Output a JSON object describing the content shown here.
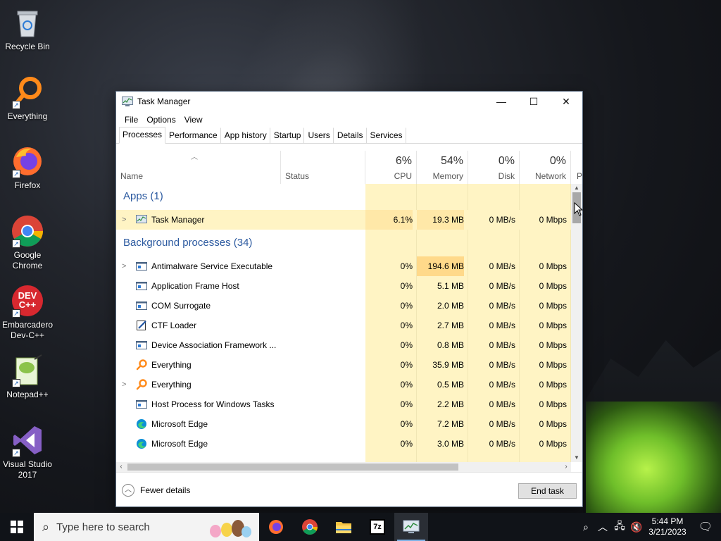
{
  "desktop": {
    "icons": [
      {
        "label": "Recycle Bin",
        "icon": "recycle-bin-icon"
      },
      {
        "label": "Everything",
        "icon": "everything-icon"
      },
      {
        "label": "Firefox",
        "icon": "firefox-icon"
      },
      {
        "label": "Google Chrome",
        "icon": "chrome-icon"
      },
      {
        "label": "Embarcadero Dev-C++",
        "icon": "devcpp-icon"
      },
      {
        "label": "Notepad++",
        "icon": "notepadpp-icon"
      },
      {
        "label": "Visual Studio 2017",
        "icon": "visual-studio-icon"
      }
    ],
    "devcpp_badge": "DEV C++"
  },
  "window": {
    "title": "Task Manager",
    "controls": {
      "minimize": "—",
      "maximize": "☐",
      "close": "✕"
    },
    "menu": [
      "File",
      "Options",
      "View"
    ],
    "tabs": [
      "Processes",
      "Performance",
      "App history",
      "Startup",
      "Users",
      "Details",
      "Services"
    ],
    "active_tab": "Processes"
  },
  "columns": {
    "name": "Name",
    "status": "Status",
    "cpu": {
      "pct": "6%",
      "label": "CPU"
    },
    "memory": {
      "pct": "54%",
      "label": "Memory"
    },
    "disk": {
      "pct": "0%",
      "label": "Disk"
    },
    "network": {
      "pct": "0%",
      "label": "Network"
    },
    "power_partial": "P"
  },
  "groups": {
    "apps": "Apps (1)",
    "background": "Background processes (34)"
  },
  "apps": [
    {
      "name": "Task Manager",
      "cpu": "6.1%",
      "memory": "19.3 MB",
      "disk": "0 MB/s",
      "network": "0 Mbps",
      "expand": true
    }
  ],
  "background": [
    {
      "name": "Antimalware Service Executable",
      "cpu": "0%",
      "memory": "194.6 MB",
      "disk": "0 MB/s",
      "network": "0 Mbps",
      "expand": true
    },
    {
      "name": "Application Frame Host",
      "cpu": "0%",
      "memory": "5.1 MB",
      "disk": "0 MB/s",
      "network": "0 Mbps",
      "expand": false
    },
    {
      "name": "COM Surrogate",
      "cpu": "0%",
      "memory": "2.0 MB",
      "disk": "0 MB/s",
      "network": "0 Mbps",
      "expand": false
    },
    {
      "name": "CTF Loader",
      "cpu": "0%",
      "memory": "2.7 MB",
      "disk": "0 MB/s",
      "network": "0 Mbps",
      "expand": false
    },
    {
      "name": "Device Association Framework ...",
      "cpu": "0%",
      "memory": "0.8 MB",
      "disk": "0 MB/s",
      "network": "0 Mbps",
      "expand": false
    },
    {
      "name": "Everything",
      "cpu": "0%",
      "memory": "35.9 MB",
      "disk": "0 MB/s",
      "network": "0 Mbps",
      "expand": false
    },
    {
      "name": "Everything",
      "cpu": "0%",
      "memory": "0.5 MB",
      "disk": "0 MB/s",
      "network": "0 Mbps",
      "expand": true
    },
    {
      "name": "Host Process for Windows Tasks",
      "cpu": "0%",
      "memory": "2.2 MB",
      "disk": "0 MB/s",
      "network": "0 Mbps",
      "expand": false
    },
    {
      "name": "Microsoft Edge",
      "cpu": "0%",
      "memory": "7.2 MB",
      "disk": "0 MB/s",
      "network": "0 Mbps",
      "expand": false
    },
    {
      "name": "Microsoft Edge",
      "cpu": "0%",
      "memory": "3.0 MB",
      "disk": "0 MB/s",
      "network": "0 Mbps",
      "expand": false
    }
  ],
  "footer": {
    "fewer_details": "Fewer details",
    "end_task": "End task"
  },
  "taskbar": {
    "search_placeholder": "Type here to search",
    "apps": [
      "firefox-icon",
      "chrome-icon",
      "file-explorer-icon",
      "7zip-icon",
      "task-manager-icon"
    ],
    "sevenzip_label": "7z",
    "time": "5:44 PM",
    "date": "3/21/2023"
  },
  "colors": {
    "heat": "#fff4c4",
    "heat_strong": "#ffe8a8",
    "group_title": "#2c5aa0",
    "taskbar": "#101318"
  }
}
